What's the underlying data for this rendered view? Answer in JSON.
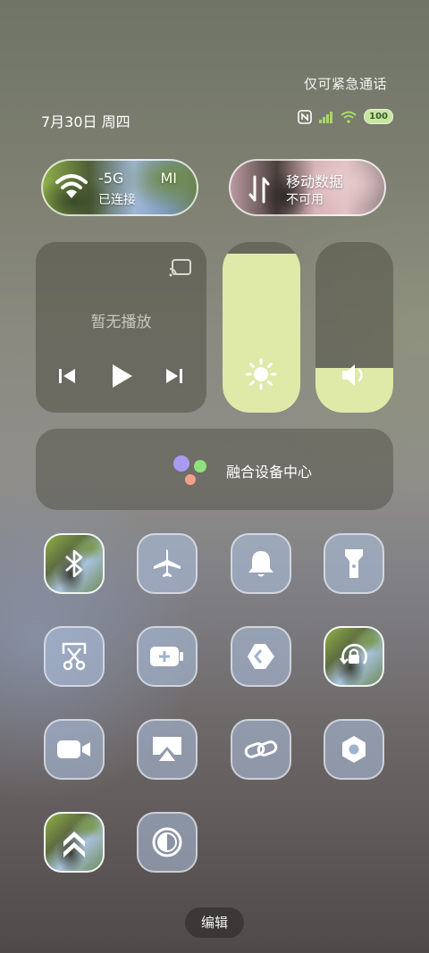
{
  "status_bar": {
    "emergency_text": "仅可紧急通话",
    "date": "7月30日 周四",
    "battery": "100",
    "icons": [
      "nfc-icon",
      "signal-icon",
      "wifi-icon",
      "battery-icon"
    ]
  },
  "wifi_pill": {
    "title": "-5G",
    "suffix": "MI",
    "subtitle": "已连接",
    "icon": "wifi-icon"
  },
  "data_pill": {
    "title": "移动数据",
    "subtitle": "不可用",
    "icon": "data-transfer-icon"
  },
  "media": {
    "status": "暂无播放",
    "icons": [
      "cast-icon",
      "previous-icon",
      "play-icon",
      "next-icon"
    ]
  },
  "brightness": {
    "level": 0.93,
    "icon": "sun-icon"
  },
  "volume": {
    "level": 0.26,
    "icon": "speaker-icon"
  },
  "fusion": {
    "label": "融合设备中心"
  },
  "tiles": [
    {
      "icon": "bluetooth-icon",
      "active": true
    },
    {
      "icon": "airplane-icon",
      "active": false
    },
    {
      "icon": "bell-icon",
      "active": false
    },
    {
      "icon": "flashlight-icon",
      "active": false
    },
    {
      "icon": "screenshot-scissors-icon",
      "active": false
    },
    {
      "icon": "battery-saver-icon",
      "active": false
    },
    {
      "icon": "share-link-icon",
      "active": false
    },
    {
      "icon": "rotation-lock-icon",
      "active": true
    },
    {
      "icon": "video-camera-icon",
      "active": false
    },
    {
      "icon": "screen-cast-icon",
      "active": false
    },
    {
      "icon": "link-icon",
      "active": false
    },
    {
      "icon": "settings-nut-icon",
      "active": false
    },
    {
      "icon": "double-chevron-up-icon",
      "active": true
    },
    {
      "icon": "contrast-icon",
      "active": false
    }
  ],
  "edit_label": "编辑",
  "colors": {
    "accent": "#dfe9a8",
    "tile": "#afc3e1",
    "panel": "#50504a"
  }
}
